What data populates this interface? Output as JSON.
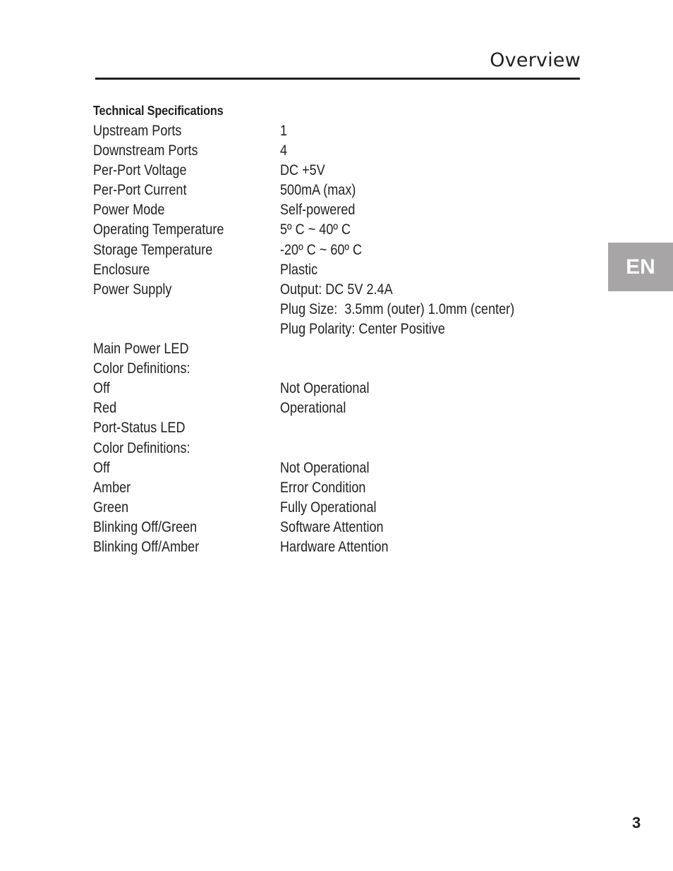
{
  "header": {
    "title": "Overview"
  },
  "section": {
    "heading": "Technical Specifications",
    "rows": [
      {
        "label": "Upstream Ports",
        "value": "1"
      },
      {
        "label": "Downstream Ports",
        "value": "4"
      },
      {
        "label": "Per-Port Voltage",
        "value": "DC +5V"
      },
      {
        "label": "Per-Port Current",
        "value": "500mA (max)"
      },
      {
        "label": "Power Mode",
        "value": "Self-powered"
      },
      {
        "label": "Operating Temperature",
        "value": "5º C ~ 40º C"
      },
      {
        "label": "Storage Temperature",
        "value": "-20º C ~ 60º C"
      },
      {
        "label": "Enclosure",
        "value": "Plastic"
      },
      {
        "label": "Power Supply",
        "value": "Output: DC 5V 2.4A"
      },
      {
        "label": "",
        "value": "Plug Size:  3.5mm (outer) 1.0mm (center)"
      },
      {
        "label": "",
        "value": "Plug Polarity: Center Positive"
      },
      {
        "label": "Main Power LED",
        "value": ""
      },
      {
        "label": "Color Definitions:",
        "value": ""
      },
      {
        "label": "Off",
        "value": "Not Operational"
      },
      {
        "label": "Red",
        "value": "Operational"
      },
      {
        "label": "Port-Status LED",
        "value": ""
      },
      {
        "label": "Color Definitions:",
        "value": ""
      },
      {
        "label": "Off",
        "value": "Not Operational"
      },
      {
        "label": "Amber",
        "value": "Error Condition"
      },
      {
        "label": "Green",
        "value": "Fully Operational"
      },
      {
        "label": "Blinking Off/Green",
        "value": "Software Attention"
      },
      {
        "label": "Blinking Off/Amber",
        "value": "Hardware Attention"
      }
    ]
  },
  "language_tab": {
    "label": "EN",
    "color": "#a7a5a6"
  },
  "footer": {
    "page_number": "3"
  }
}
